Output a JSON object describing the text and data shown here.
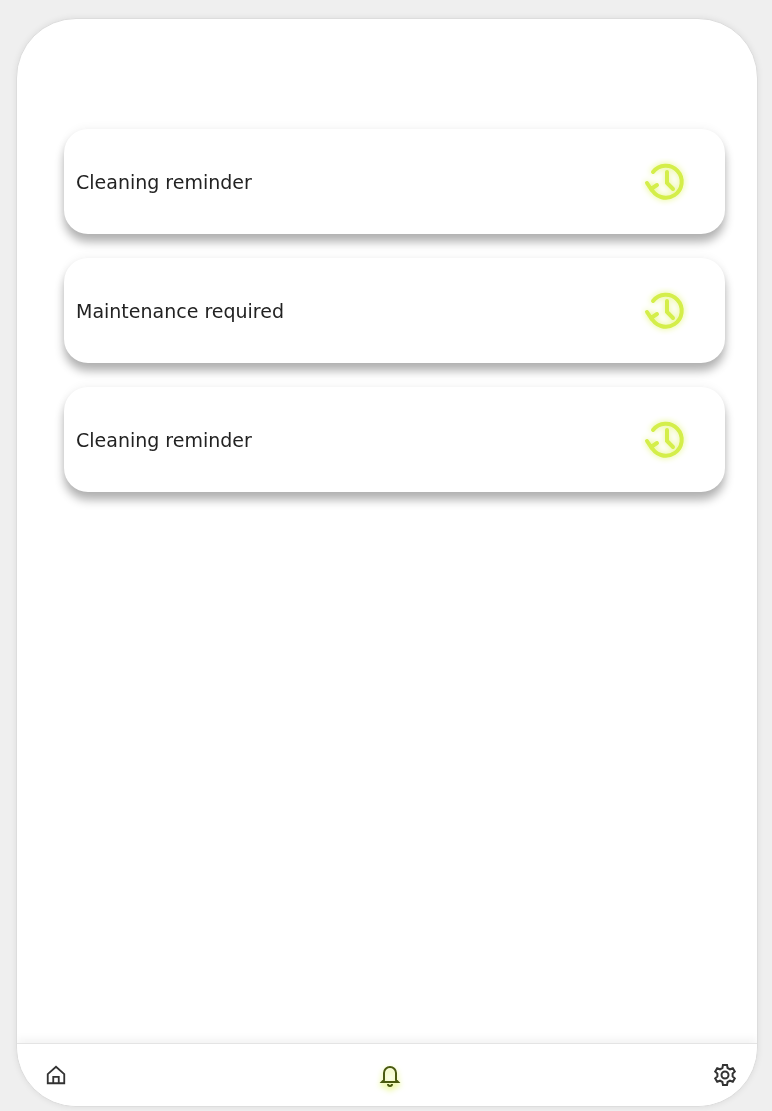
{
  "notifications": [
    {
      "title": "Cleaning reminder"
    },
    {
      "title": "Maintenance required"
    },
    {
      "title": "Cleaning reminder"
    }
  ],
  "nav": [
    {
      "kind": "home",
      "selected": false
    },
    {
      "kind": "notifications",
      "selected": true
    },
    {
      "kind": "settings",
      "selected": false
    }
  ]
}
